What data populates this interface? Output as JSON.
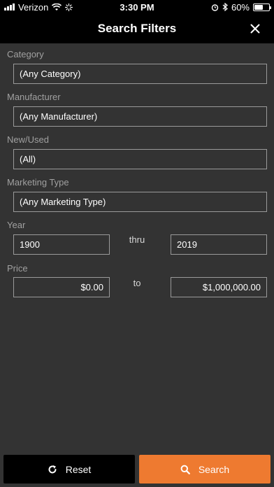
{
  "status_bar": {
    "carrier": "Verizon",
    "time": "3:30 PM",
    "battery": "60%",
    "battery_level": 0.6
  },
  "nav": {
    "title": "Search Filters",
    "close_icon": "close-icon"
  },
  "filters": {
    "category": {
      "label": "Category",
      "value": "(Any Category)"
    },
    "manufacturer": {
      "label": "Manufacturer",
      "value": "(Any Manufacturer)"
    },
    "new_used": {
      "label": "New/Used",
      "value": "(All)"
    },
    "marketing_type": {
      "label": "Marketing Type",
      "value": "(Any Marketing Type)"
    },
    "year": {
      "label": "Year",
      "from": "1900",
      "separator": "thru",
      "to": "2019"
    },
    "price": {
      "label": "Price",
      "from": "$0.00",
      "separator": "to",
      "to": "$1,000,000.00"
    }
  },
  "buttons": {
    "reset": {
      "label": "Reset",
      "icon": "refresh-icon"
    },
    "search": {
      "label": "Search",
      "icon": "search-icon"
    }
  },
  "colors": {
    "background": "#333333",
    "bar": "#000000",
    "accent": "#ee7a30",
    "label": "#a0a0a0",
    "border": "#9a9a9a"
  }
}
